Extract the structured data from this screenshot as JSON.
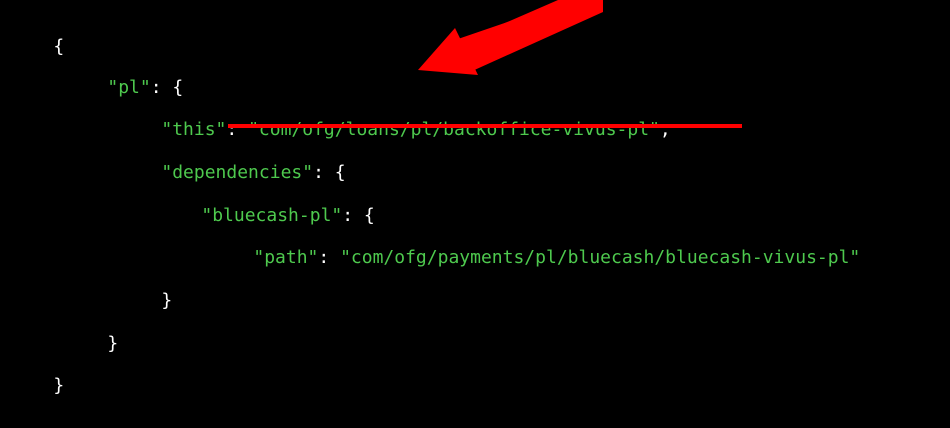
{
  "code": {
    "open_brace": "{",
    "pl_key": "\"pl\"",
    "pl_colon_open": ": {",
    "this_key": "\"this\"",
    "colon_sep": ": ",
    "this_value": "\"com/ofg/loans/pl/backoffice-vivus-pl\"",
    "comma": ",",
    "dependencies_key": "\"dependencies\"",
    "dependencies_colon_open": ": {",
    "bluecash_key": "\"bluecash-pl\"",
    "bluecash_colon_open": ": {",
    "path_key": "\"path\"",
    "path_value": "\"com/ofg/payments/pl/bluecash/bluecash-vivus-pl\"",
    "close_brace_inner": "}",
    "close_brace_pl": "}",
    "close_brace_root": "}"
  },
  "colors": {
    "background": "#000000",
    "string": "#4ec94e",
    "punctuation": "#ffffff",
    "annotation": "#ff0000"
  },
  "annotations": {
    "arrow_icon": "red-arrow-icon",
    "underline": "red-underline"
  }
}
